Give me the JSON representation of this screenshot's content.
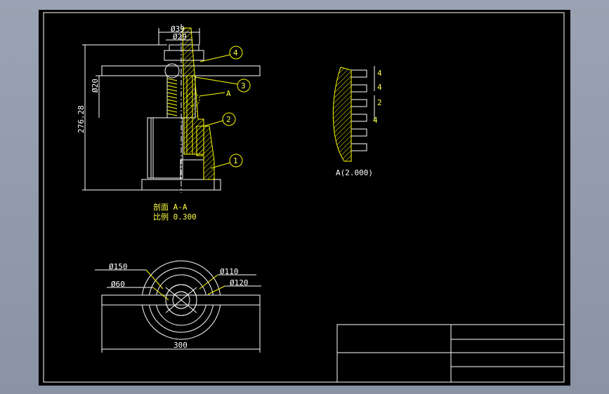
{
  "colors": {
    "window_bg": "#9aa3b3",
    "sheet_bg": "#000000",
    "frame": "#ffffff",
    "outline": "#ffffff",
    "dimension": "#ffffff",
    "leader": "#ffff00",
    "hatch": "#ffff00"
  },
  "front_view": {
    "dims": {
      "outer_dia": "Ø39",
      "thread_dia": "Ø29",
      "screw_dia": "Ø20",
      "overall_height": "276.28"
    },
    "balloons": [
      "4",
      "3",
      "2",
      "1"
    ],
    "detail_callout": "A",
    "section_title": "剖面  A-A",
    "scale_label": "比例 0.300"
  },
  "detail_view": {
    "dims": [
      "4",
      "4",
      "2",
      "4"
    ],
    "caption": "A(2.000)"
  },
  "top_view": {
    "dims": {
      "d150": "Ø150",
      "d110": "Ø110",
      "d60": "Ø60",
      "d120": "Ø120",
      "length": "300"
    }
  },
  "title_block": {
    "cells": []
  }
}
